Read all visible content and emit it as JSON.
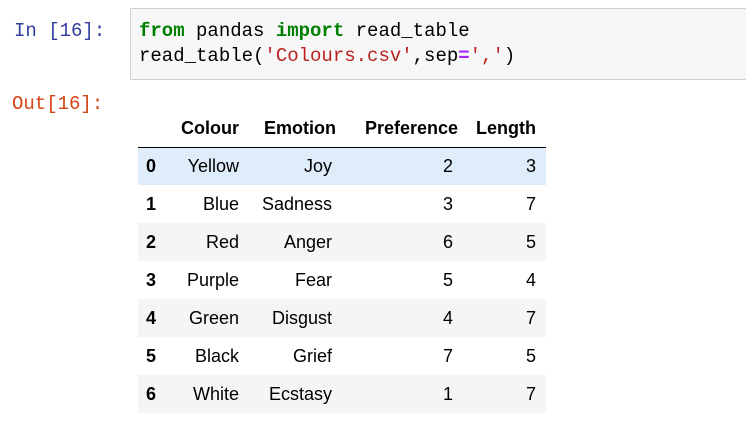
{
  "input_prompt": "In [16]:",
  "output_prompt": "Out[16]:",
  "code": {
    "line1": {
      "kw1": "from",
      "mod": " pandas ",
      "kw2": "import",
      "name": " read_table"
    },
    "line2": {
      "fn": "read_table(",
      "s1": "'Colours.csv'",
      "comma": ",sep",
      "eq": "=",
      "s2": "','",
      "close": ")"
    }
  },
  "table": {
    "columns": [
      "",
      "Colour",
      "Emotion",
      "Preference",
      "Length"
    ],
    "rows": [
      {
        "index": "0",
        "cells": [
          "Yellow",
          "Joy",
          "2",
          "3"
        ]
      },
      {
        "index": "1",
        "cells": [
          "Blue",
          "Sadness",
          "3",
          "7"
        ]
      },
      {
        "index": "2",
        "cells": [
          "Red",
          "Anger",
          "6",
          "5"
        ]
      },
      {
        "index": "3",
        "cells": [
          "Purple",
          "Fear",
          "5",
          "4"
        ]
      },
      {
        "index": "4",
        "cells": [
          "Green",
          "Disgust",
          "4",
          "7"
        ]
      },
      {
        "index": "5",
        "cells": [
          "Black",
          "Grief",
          "7",
          "5"
        ]
      },
      {
        "index": "6",
        "cells": [
          "White",
          "Ecstasy",
          "1",
          "7"
        ]
      }
    ]
  },
  "colors": {
    "in_prompt": "#303f9f",
    "out_prompt": "#d84315",
    "keyword": "#008000",
    "string": "#ba2121",
    "hover_row": "#dfecf9",
    "striped_row": "#f5f5f5"
  }
}
